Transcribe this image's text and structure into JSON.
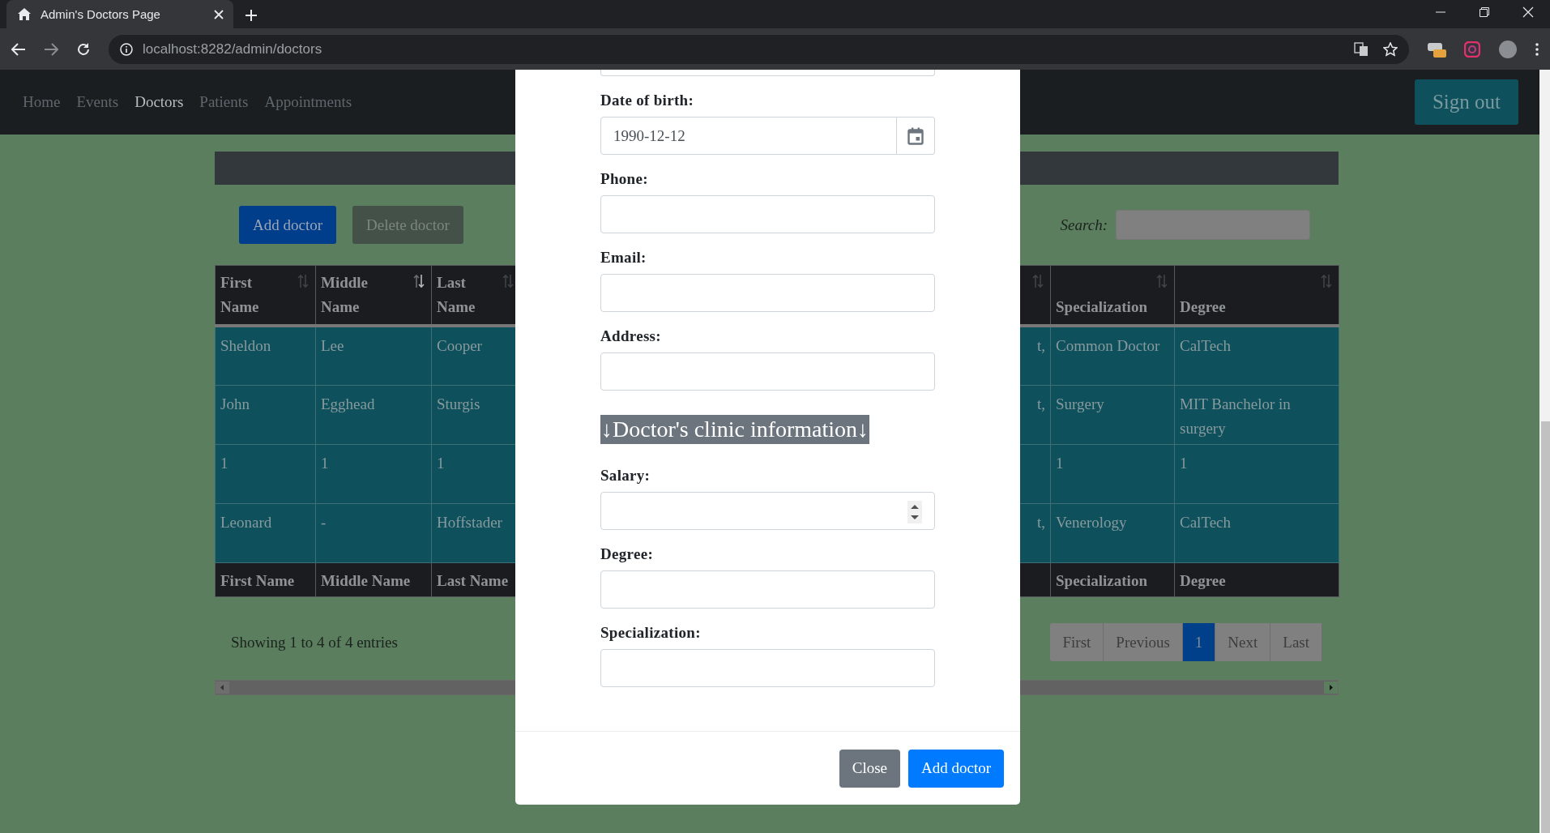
{
  "browser": {
    "tab_title": "Admin's Doctors Page",
    "url": "localhost:8282/admin/doctors"
  },
  "navbar": {
    "links": [
      {
        "label": "Home",
        "selected": false
      },
      {
        "label": "Events",
        "selected": false
      },
      {
        "label": "Doctors",
        "selected": true
      },
      {
        "label": "Patients",
        "selected": false
      },
      {
        "label": "Appointments",
        "selected": false
      }
    ],
    "sign_out": "Sign out"
  },
  "toolbar": {
    "buttons": [
      {
        "label": "Add doctor",
        "kind": "primary"
      },
      {
        "label": "Delete doctor",
        "kind": "disabled"
      }
    ],
    "search_label": "Search:"
  },
  "table": {
    "columns": [
      {
        "label": "First Name",
        "sorted": false
      },
      {
        "label": "Middle Name",
        "sorted": true
      },
      {
        "label": "Last Name",
        "sorted": false
      },
      {
        "sorted": false
      },
      {
        "label": "Specialization",
        "sorted": false
      },
      {
        "label": "Degree",
        "sorted": false
      }
    ],
    "rows": [
      [
        "Sheldon",
        "Lee",
        "Cooper",
        "t,",
        "Common Doctor",
        "CalTech"
      ],
      [
        "John",
        "Egghead",
        "Sturgis",
        "t,",
        "Surgery",
        "MIT Banchelor in surgery"
      ],
      [
        "1",
        "1",
        "1",
        "",
        "1",
        "1"
      ],
      [
        "Leonard",
        "-",
        "Hoffstader",
        "t,",
        "Venerology",
        "CalTech"
      ]
    ],
    "footer_left": [
      "First Name",
      "Middle Name",
      "Last Name"
    ],
    "footer_right": [
      "Specialization",
      "Degree"
    ]
  },
  "info": "Showing 1 to 4 of 4 entries",
  "pagination": [
    {
      "label": "First",
      "selected": false
    },
    {
      "label": "Previous",
      "selected": false
    },
    {
      "label": "1",
      "selected": true
    },
    {
      "label": "Next",
      "selected": false
    },
    {
      "label": "Last",
      "selected": false
    }
  ],
  "modal": {
    "fields": [
      {
        "kind": "text"
      },
      {
        "kind": "date",
        "label": "Date of birth:",
        "value": "1990-12-12"
      },
      {
        "kind": "text",
        "label": "Phone:"
      },
      {
        "kind": "text",
        "label": "Email:"
      },
      {
        "kind": "text",
        "label": "Address:"
      },
      {
        "kind": "section",
        "label": "↓Doctor's clinic information↓"
      },
      {
        "kind": "number",
        "label": "Salary:"
      },
      {
        "kind": "text",
        "label": "Degree:"
      },
      {
        "kind": "text",
        "label": "Specialization:"
      }
    ],
    "buttons": [
      {
        "label": "Close",
        "kind": "secondary"
      },
      {
        "label": "Add doctor",
        "kind": "primary"
      }
    ]
  }
}
